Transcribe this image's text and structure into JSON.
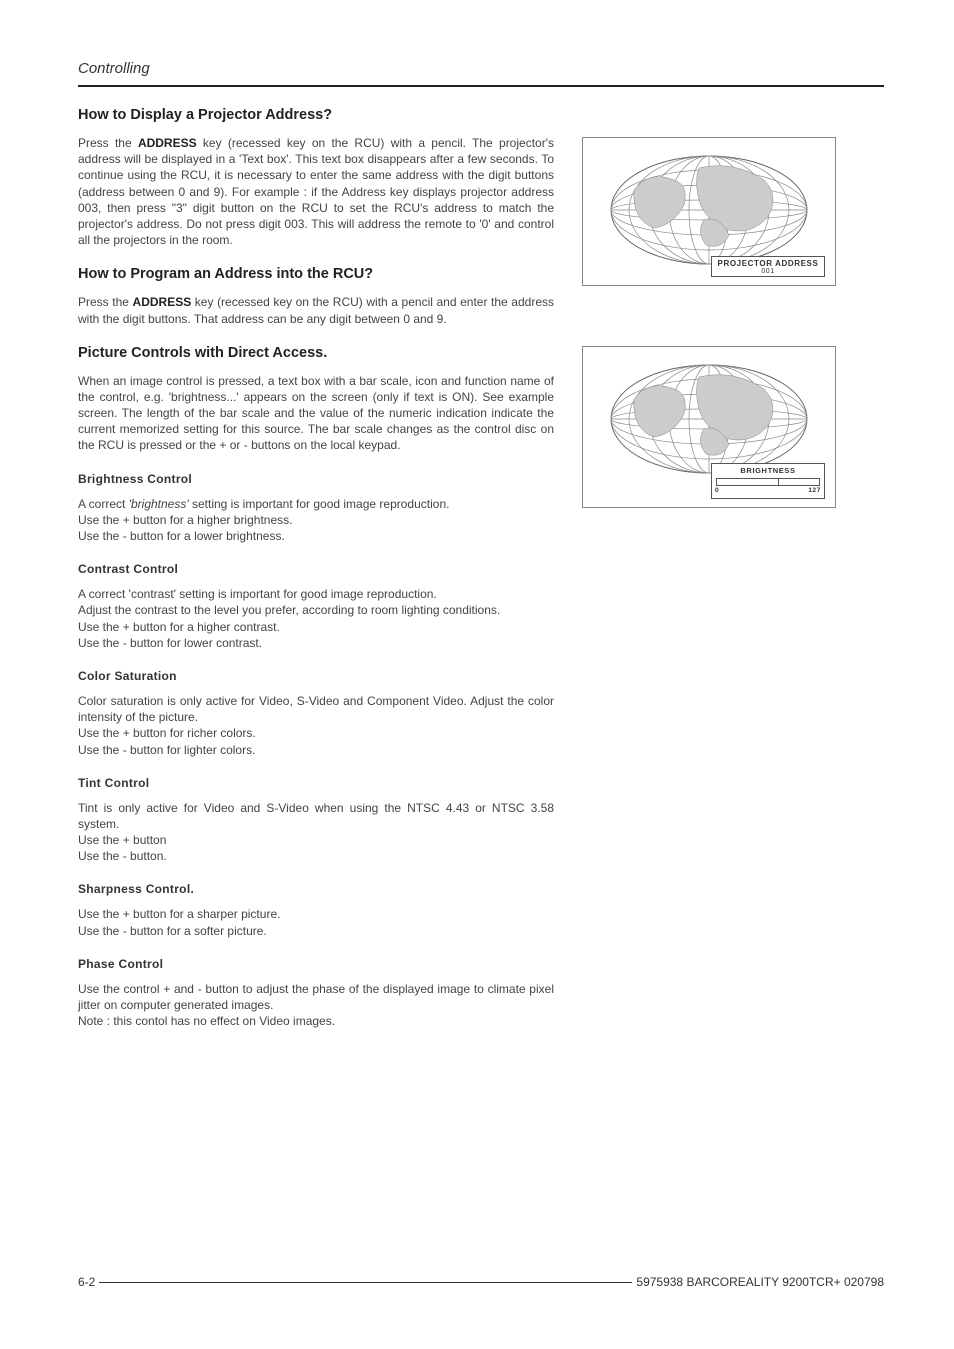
{
  "header": {
    "section": "Controlling"
  },
  "s1": {
    "title": "How to Display a Projector Address?",
    "p1_a": "Press the ",
    "p1_b": "ADDRESS",
    "p1_c": " key (recessed key on the RCU) with a pencil.  The projector's address will be displayed in a 'Text box'.  This text box disappears after a few seconds.  To continue using the RCU, it is necessary to enter the same address with the digit buttons (address between 0 and 9).  For example : if the Address key displays projector address 003, then press \"3\" digit button on the RCU to set the RCU's address to match the projector's address.  Do not press digit 003.  This will address the remote to '0' and control all the projectors in the room."
  },
  "s2": {
    "title": "How to Program an Address into the RCU?",
    "p1_a": "Press the ",
    "p1_b": "ADDRESS",
    "p1_c": " key (recessed key on the RCU) with a pencil and enter the address with the digit buttons.  That address can be any digit between 0 and 9."
  },
  "s3": {
    "title": "Picture Controls with Direct Access.",
    "intro": "When an image control is pressed, a text box with a bar scale, icon and function name of the control, e.g. 'brightness...' appears on the screen (only if text is ON).   See example screen.  The length of the bar scale and the value of the numeric indication indicate the current memorized setting for this source.  The bar scale changes as the control disc on the RCU is pressed  or the + or - buttons on the local keypad.",
    "brightness": {
      "h": "Brightness  Control",
      "l1_a": "A correct ",
      "l1_b": "'brightness'",
      "l1_c": " setting is important for good image reproduction.",
      "l2": "Use the + button for a higher brightness.",
      "l3": "Use the - button for a lower brightness."
    },
    "contrast": {
      "h": "Contrast  Control",
      "l1": "A correct 'contrast' setting is important for good image reproduction.",
      "l2": "Adjust the contrast to the level you prefer, according to room lighting conditions.",
      "l3": "Use the + button for a higher contrast.",
      "l4": "Use the - button for lower contrast."
    },
    "color": {
      "h": "Color  Saturation",
      "l1": "Color saturation is only active for Video, S-Video and Component Video.  Adjust the color intensity of the picture.",
      "l2": "Use the + button for richer colors.",
      "l3": "Use the - button for lighter colors."
    },
    "tint": {
      "h": "Tint  Control",
      "l1": "Tint is only active for Video and S-Video when using the NTSC 4.43 or NTSC 3.58 system.",
      "l2": "Use the + button",
      "l3": "Use the - button."
    },
    "sharp": {
      "h": "Sharpness  Control.",
      "l1": "Use the + button for a sharper picture.",
      "l2": "Use the - button for a softer picture."
    },
    "phase": {
      "h": "Phase  Control",
      "l1": "Use the control + and - button to adjust the phase of the displayed image to climate pixel jitter on computer generated images.",
      "l2": "Note : this contol has no effect on Video images."
    }
  },
  "fig1": {
    "label": "PROJECTOR  ADDRESS",
    "value": "001"
  },
  "fig2": {
    "label": "BRIGHTNESS",
    "min": "0",
    "max": "127"
  },
  "footer": {
    "page": "6-2",
    "doc": "5975938 BARCOREALITY 9200TCR+ 020798"
  }
}
